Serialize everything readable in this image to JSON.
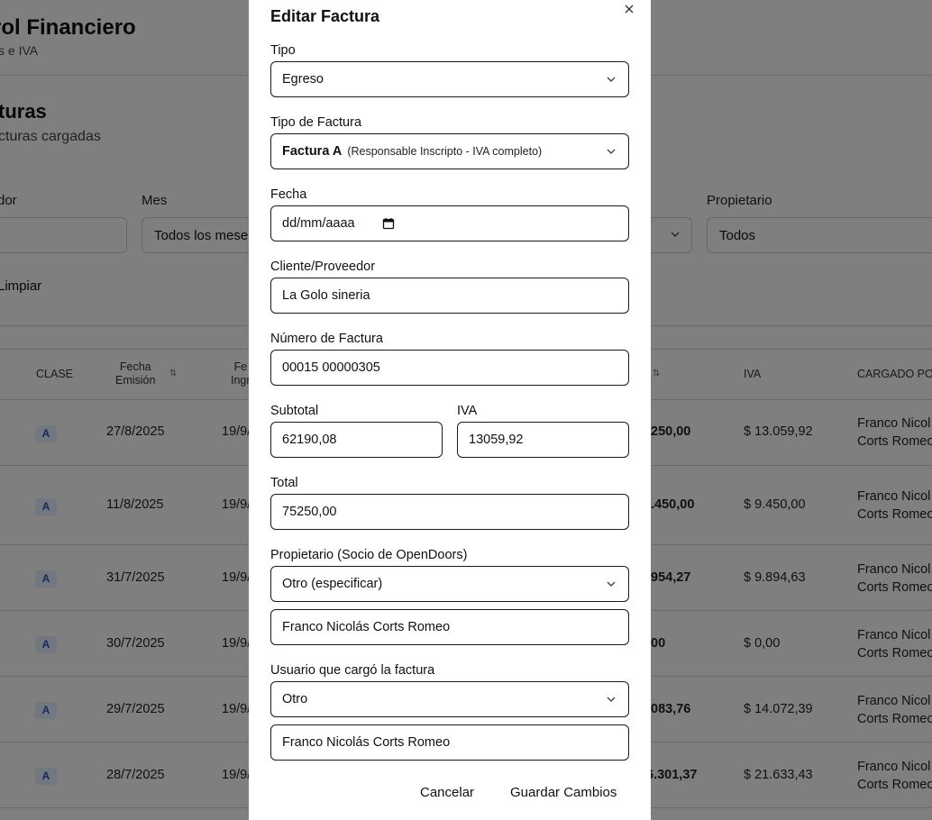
{
  "background": {
    "app_title": "rol Financiero",
    "app_subtitle": "s e IVA",
    "section_title": "turas",
    "section_subtitle": "cturas cargadas",
    "filters": {
      "label_search": "dor",
      "label_month": "Mes",
      "month_value": "Todos los meses",
      "label_owner": "Propietario",
      "owner_value": "Todos",
      "clear_label": "Limpiar"
    },
    "table": {
      "headers": {
        "clase": "CLASE",
        "fecha_emision": "Fecha\nEmisión",
        "fecha_ingreso": "Fe\nIngr",
        "iva": "IVA",
        "cargado_por": "CARGADO POR"
      },
      "rows": [
        {
          "clase": "A",
          "fecha_emision": "27/8/2025",
          "fecha_ingreso": "19/9/",
          "total": "250,00",
          "iva": "$ 13.059,92",
          "cargado_por_1": "Franco Nicol",
          "cargado_por_2": "Corts Romeo"
        },
        {
          "clase": "A",
          "fecha_emision": "11/8/2025",
          "fecha_ingreso": "19/9/",
          "total": ".450,00",
          "iva": "$ 9.450,00",
          "cargado_por_1": "Franco Nicol",
          "cargado_por_2": "Corts Romeo"
        },
        {
          "clase": "A",
          "fecha_emision": "31/7/2025",
          "fecha_ingreso": "19/9/",
          "total": "954,27",
          "iva": "$ 9.894,63",
          "cargado_por_1": "Franco Nicol",
          "cargado_por_2": "Corts Romeo"
        },
        {
          "clase": "A",
          "fecha_emision": "30/7/2025",
          "fecha_ingreso": "19/9/",
          "total": "00",
          "iva": "$ 0,00",
          "cargado_por_1": "Franco Nicol",
          "cargado_por_2": "Corts Romeo"
        },
        {
          "clase": "A",
          "fecha_emision": "29/7/2025",
          "fecha_ingreso": "19/9/",
          "total": "083,76",
          "iva": "$ 14.072,39",
          "cargado_por_1": "Franco Nicol",
          "cargado_por_2": "Corts Romeo"
        },
        {
          "clase": "A",
          "fecha_emision": "28/7/2025",
          "fecha_ingreso": "19/9/",
          "total": "6.301,37",
          "iva": "$ 21.633,43",
          "cargado_por_1": "Franco Nicol",
          "cargado_por_2": "Corts Romeo"
        }
      ]
    }
  },
  "modal": {
    "title": "Editar Factura",
    "close_icon": "close-icon",
    "tipo": {
      "label": "Tipo",
      "value": "Egreso"
    },
    "tipo_factura": {
      "label": "Tipo de Factura",
      "value": "Factura A",
      "hint": "(Responsable Inscripto - IVA completo)"
    },
    "fecha": {
      "label": "Fecha",
      "placeholder": "dd/mm/aaaa"
    },
    "cliente": {
      "label": "Cliente/Proveedor",
      "value": "La Golo sineria"
    },
    "numero": {
      "label": "Número de Factura",
      "value": "00015 00000305"
    },
    "subtotal": {
      "label": "Subtotal",
      "value": "62190,08"
    },
    "iva": {
      "label": "IVA",
      "value": "13059,92"
    },
    "total": {
      "label": "Total",
      "value": "75250,00"
    },
    "propietario": {
      "label": "Propietario (Socio de OpenDoors)",
      "value": "Otro (especificar)",
      "other_value": "Franco Nicolás Corts Romeo"
    },
    "usuario": {
      "label": "Usuario que cargó la factura",
      "value": "Otro",
      "other_value": "Franco Nicolás Corts Romeo"
    },
    "cancel_label": "Cancelar",
    "save_label": "Guardar Cambios"
  }
}
